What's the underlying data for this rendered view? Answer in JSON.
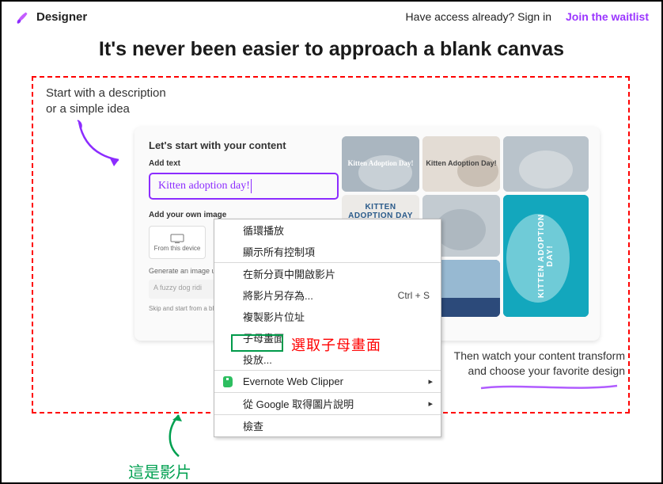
{
  "header": {
    "brand": "Designer",
    "signin": "Have access already? Sign in",
    "join": "Join the waitlist"
  },
  "hero": "It's never been easier to approach a blank canvas",
  "intro": "Start with a description\nor a simple idea",
  "card": {
    "head": "Let's start with your content",
    "addtext": "Add text",
    "prompt": "Kitten adoption day!",
    "addimg": "Add your own image",
    "device": "From this device",
    "gen": "Generate an image using",
    "placeholder": "A fuzzy dog ridi",
    "skip": "Skip and start from a blan"
  },
  "tiles": {
    "t1": "Kitten\nAdoption\nDay!",
    "t2": "Kitten\nAdoption\nDay!",
    "t4": "KITTEN\nADOPTION\nDAY",
    "t7": "KITTEN ADOPTION DAY!"
  },
  "ctx": {
    "loop": "循環播放",
    "controls": "顯示所有控制項",
    "newtab": "在新分頁中開啟影片",
    "saveas": "將影片另存為...",
    "saveas_key": "Ctrl + S",
    "copyloc": "複製影片位址",
    "pip": "子母畫面",
    "cast": "投放...",
    "evernote": "Evernote Web Clipper",
    "googleimg": "從 Google 取得圖片說明",
    "inspect": "檢查"
  },
  "annot": {
    "red": "選取子母畫面",
    "green": "這是影片"
  },
  "outro": "Then watch your content transform\nand choose your favorite design"
}
